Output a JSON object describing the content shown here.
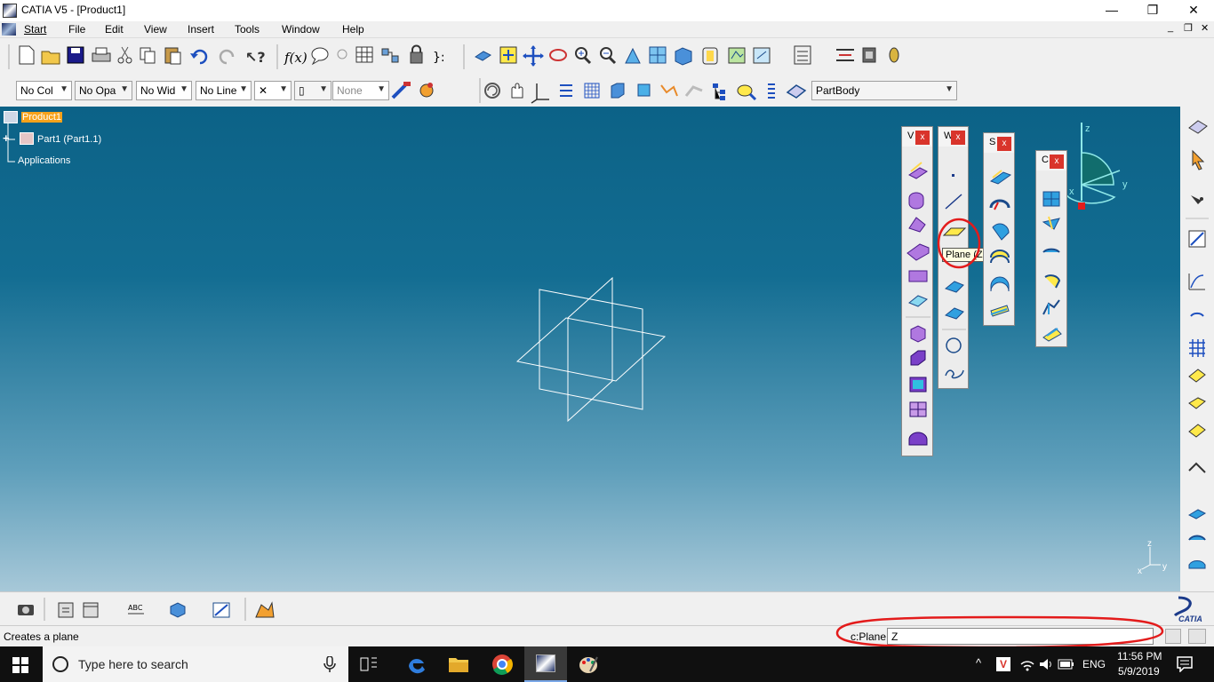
{
  "window": {
    "title": "CATIA V5 - [Product1]",
    "minimize": "—",
    "restore": "❐",
    "close": "✕"
  },
  "menu": {
    "items": [
      "Start",
      "File",
      "Edit",
      "View",
      "Insert",
      "Tools",
      "Window",
      "Help"
    ]
  },
  "toolbar2": {
    "color": "No Col",
    "opacity": "No Opa",
    "width": "No Wid",
    "linetype": "No Line",
    "point_symbol": "✕",
    "layer": "None",
    "current_body": "PartBody"
  },
  "tree": {
    "root": "Product1",
    "part": "Part1 (Part1.1)",
    "applications": "Applications"
  },
  "floating_toolbars": {
    "views_title": "V",
    "wireframe_title": "W",
    "surfaces_title": "S",
    "operations_title": "C",
    "close_label": "x"
  },
  "tooltip": {
    "text": "Plane (Z"
  },
  "compass": {
    "z": "z",
    "y": "y",
    "x": "x"
  },
  "axis_indicator": {
    "z": "z",
    "y": "y",
    "x": "x"
  },
  "status": {
    "message": "Creates a plane",
    "command_label": "c:Plane",
    "command_value": "Z"
  },
  "taskbar": {
    "search_placeholder": "Type here to search",
    "language": "ENG",
    "time": "11:56 PM",
    "date": "5/9/2019"
  },
  "colors": {
    "viewport_top": "#0c6287",
    "viewport_bottom": "#a7c8d8",
    "highlight": "#f7a21b",
    "annotation_red": "#e31b1b"
  }
}
